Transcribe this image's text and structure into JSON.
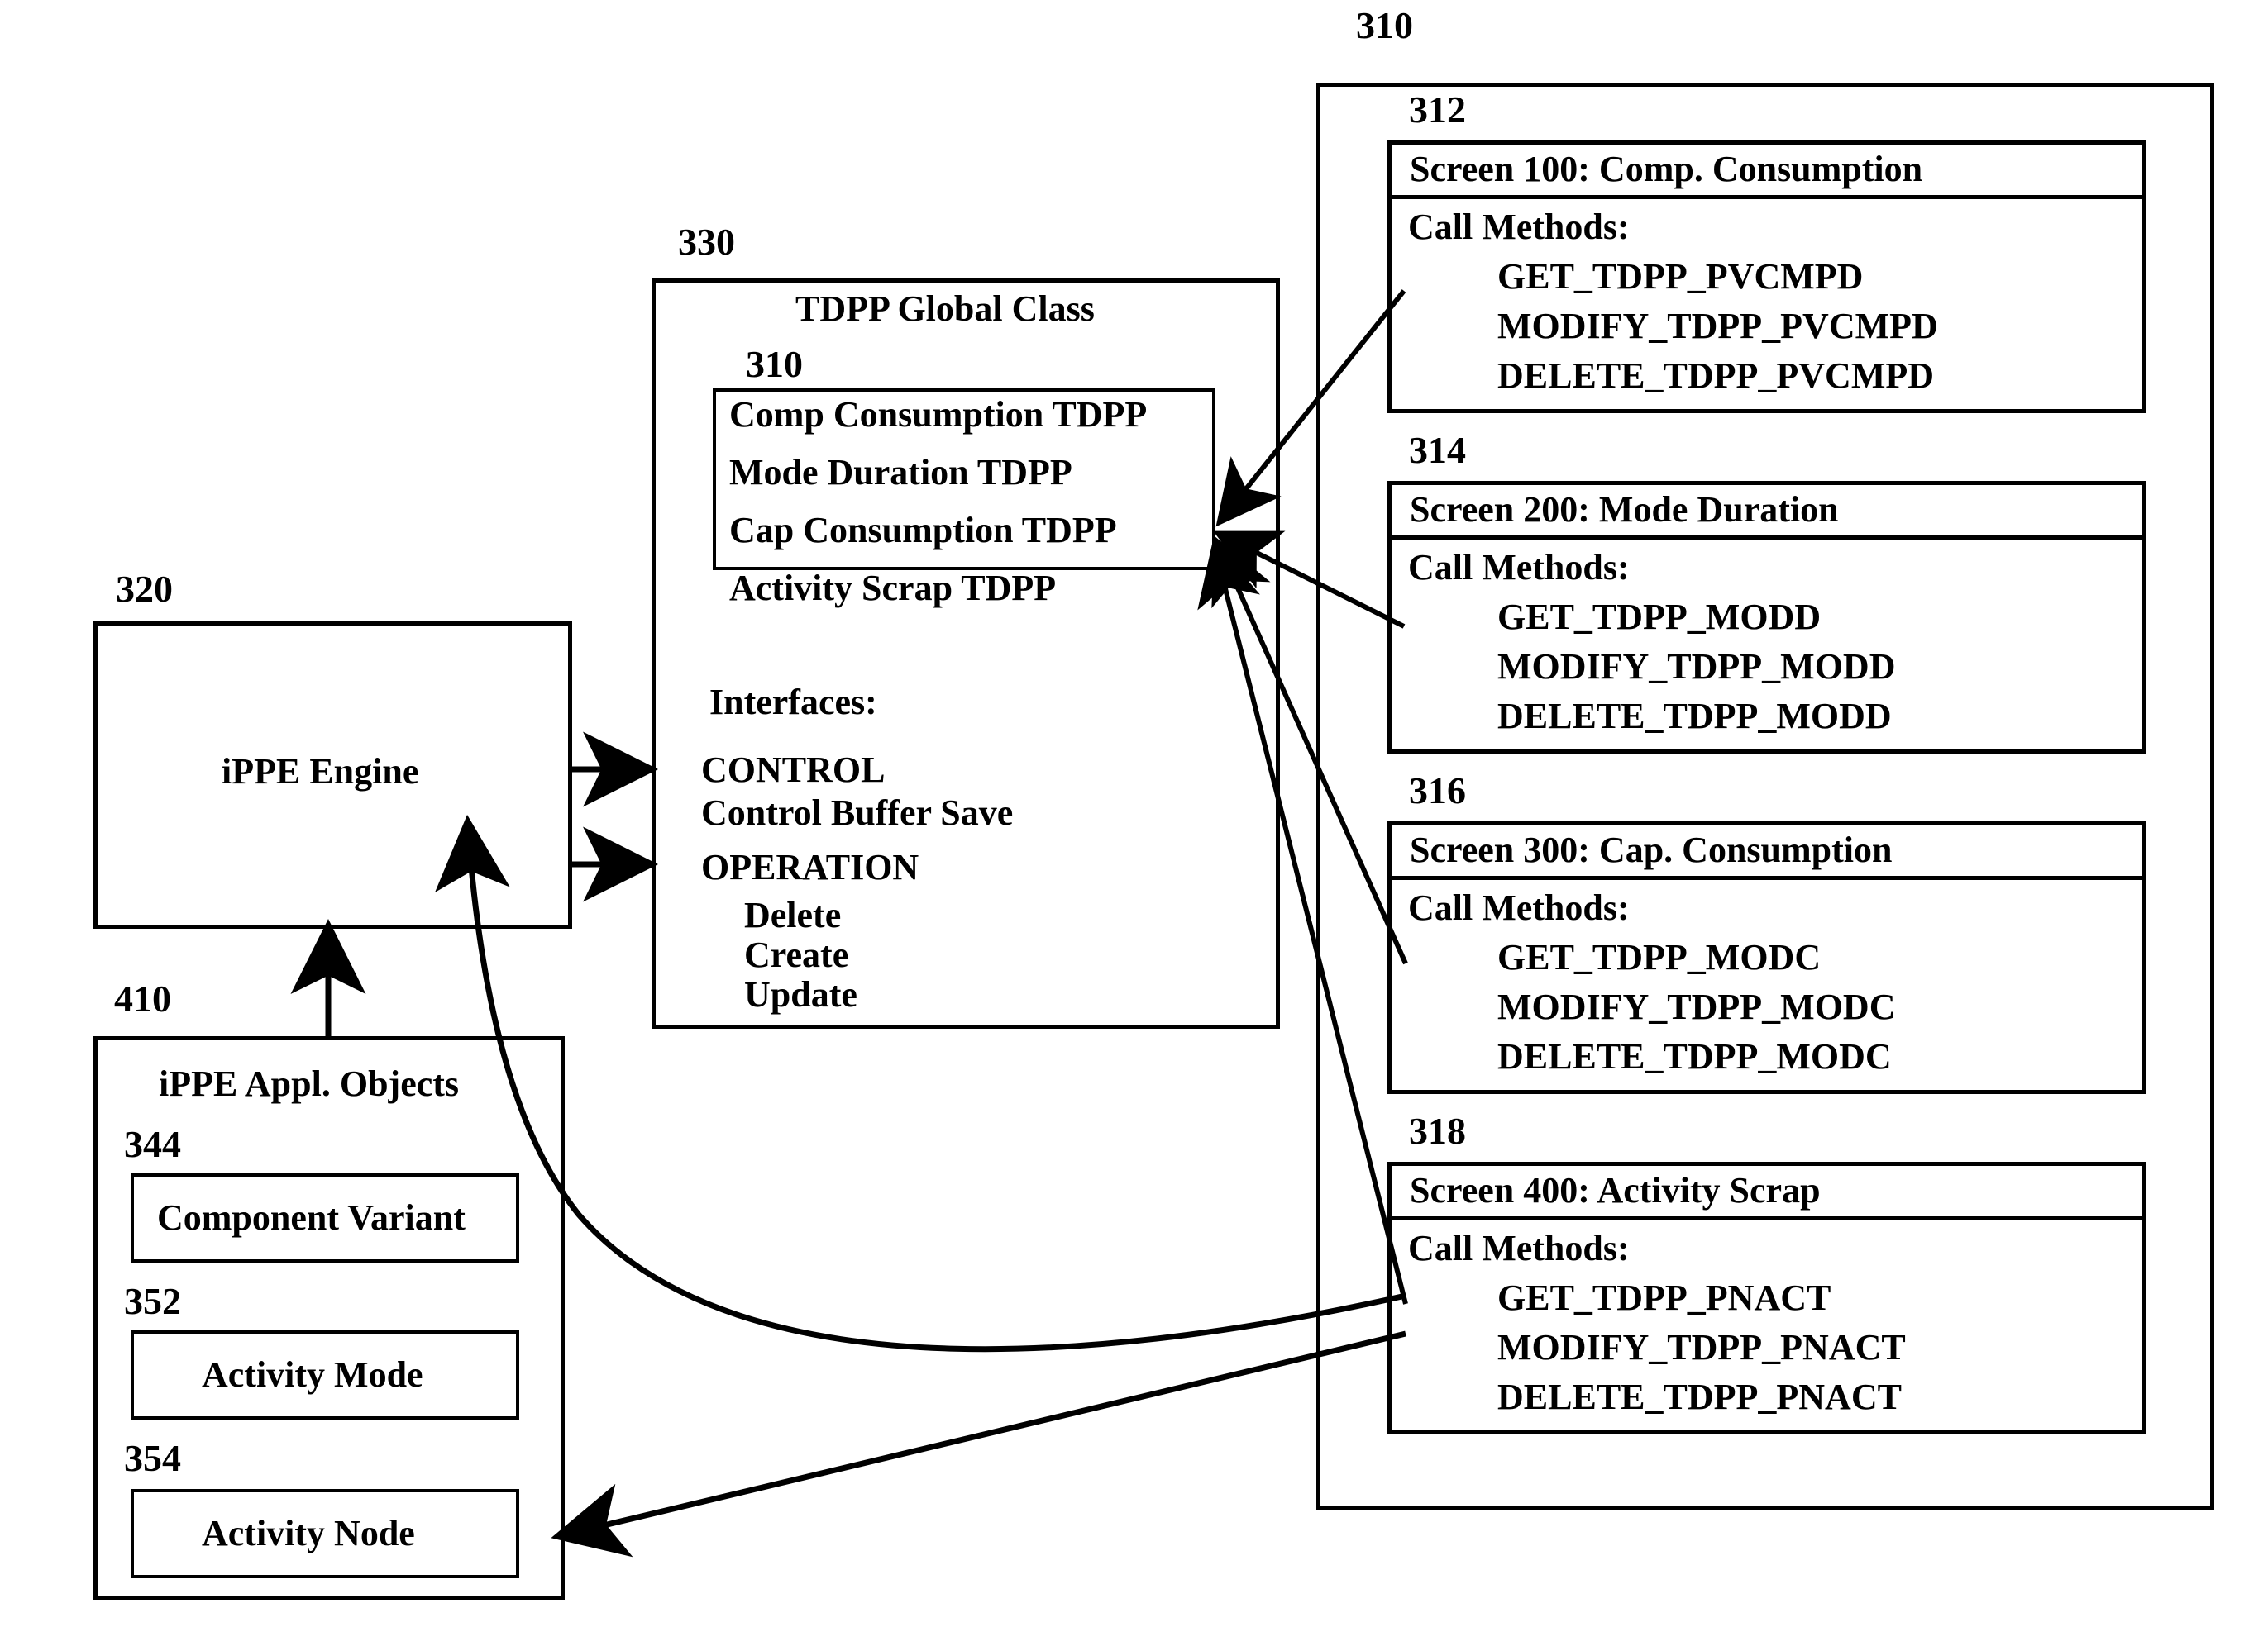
{
  "diagram": {
    "ref_outer": "310",
    "right_panel": {
      "screens": [
        {
          "ref": "312",
          "title": "Screen 100: Comp. Consumption",
          "methods_label": "Call Methods:",
          "methods": [
            "GET_TDPP_PVCMPD",
            "MODIFY_TDPP_PVCMPD",
            "DELETE_TDPP_PVCMPD"
          ]
        },
        {
          "ref": "314",
          "title": "Screen 200: Mode Duration",
          "methods_label": "Call Methods:",
          "methods": [
            "GET_TDPP_MODD",
            "MODIFY_TDPP_MODD",
            "DELETE_TDPP_MODD"
          ]
        },
        {
          "ref": "316",
          "title": "Screen 300: Cap. Consumption",
          "methods_label": "Call Methods:",
          "methods": [
            "GET_TDPP_MODC",
            "MODIFY_TDPP_MODC",
            "DELETE_TDPP_MODC"
          ]
        },
        {
          "ref": "318",
          "title": "Screen 400: Activity Scrap",
          "methods_label": "Call Methods:",
          "methods": [
            "GET_TDPP_PNACT",
            "MODIFY_TDPP_PNACT",
            "DELETE_TDPP_PNACT"
          ]
        }
      ]
    },
    "tdpp_global_class": {
      "ref": "330",
      "title": "TDPP Global Class",
      "inner_ref": "310",
      "inner_items": [
        "Comp Consumption TDPP",
        "Mode Duration TDPP",
        "Cap Consumption TDPP",
        "Activity Scrap TDPP"
      ],
      "interfaces_label": "Interfaces:",
      "control_label": "CONTROL",
      "control_item": "Control Buffer Save",
      "operation_label": "OPERATION",
      "operation_items": [
        "Delete",
        "Create",
        "Update"
      ]
    },
    "ippe_engine": {
      "ref": "320",
      "title": "iPPE Engine"
    },
    "ippe_appl_objects": {
      "ref": "410",
      "title": "iPPE Appl. Objects",
      "objects": [
        {
          "ref": "344",
          "label": "Component Variant"
        },
        {
          "ref": "352",
          "label": "Activity Mode"
        },
        {
          "ref": "354",
          "label": "Activity Node"
        }
      ]
    },
    "colors": {
      "line": "#000000",
      "background": "#ffffff"
    }
  }
}
